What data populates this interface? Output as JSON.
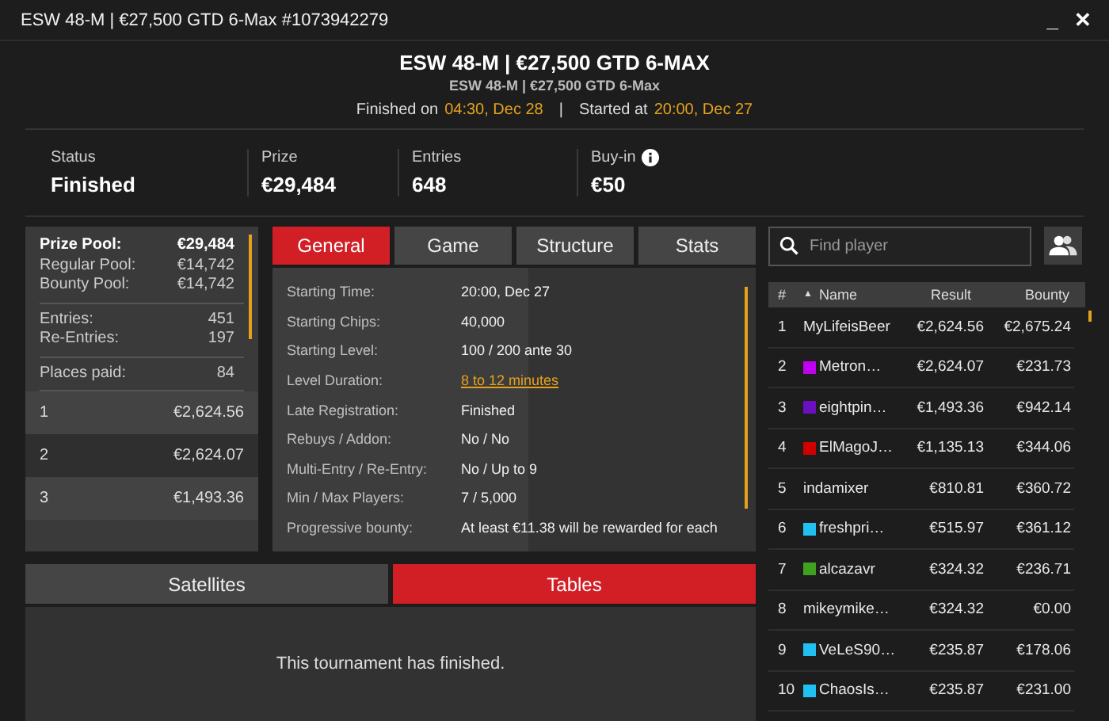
{
  "window": {
    "title": "ESW 48-M | €27,500 GTD 6-Max #1073942279",
    "controls": [
      "_",
      "✕"
    ]
  },
  "header": {
    "title": "ESW 48-M | €27,500 GTD 6-MAX",
    "subtitle": "ESW 48-M | €27,500 GTD 6-Max",
    "finished_label": "Finished on",
    "finished_time": "04:30, Dec 28",
    "separator": "|",
    "started_label": "Started at",
    "started_time": "20:00, Dec 27"
  },
  "stats": [
    {
      "label": "Status",
      "value": "Finished",
      "info": false
    },
    {
      "label": "Prize",
      "value": "€29,484",
      "info": false
    },
    {
      "label": "Entries",
      "value": "648",
      "info": false
    },
    {
      "label": "Buy-in",
      "value": "€50",
      "info": true
    }
  ],
  "prize_summary": {
    "groups": [
      [
        {
          "label": "Prize Pool:",
          "value": "€29,484",
          "bold": true
        },
        {
          "label": "Regular Pool:",
          "value": "€14,742",
          "bold": false
        },
        {
          "label": "Bounty Pool:",
          "value": "€14,742",
          "bold": false
        }
      ],
      [
        {
          "label": "Entries:",
          "value": "451",
          "bold": false
        },
        {
          "label": "Re-Entries:",
          "value": "197",
          "bold": false
        }
      ],
      [
        {
          "label": "Places paid:",
          "value": "84",
          "bold": false
        }
      ]
    ],
    "places": [
      {
        "place": "1",
        "prize": "€2,624.56"
      },
      {
        "place": "2",
        "prize": "€2,624.07"
      },
      {
        "place": "3",
        "prize": "€1,493.36"
      }
    ]
  },
  "tabs": [
    {
      "label": "General",
      "selected": true
    },
    {
      "label": "Game",
      "selected": false
    },
    {
      "label": "Structure",
      "selected": false
    },
    {
      "label": "Stats",
      "selected": false
    }
  ],
  "details": [
    {
      "label": "Starting Time:",
      "value": "20:00, Dec 27",
      "kind": "text"
    },
    {
      "label": "Starting Chips:",
      "value": "40,000",
      "kind": "text"
    },
    {
      "label": "Starting Level:",
      "value": "100 / 200 ante 30",
      "kind": "text"
    },
    {
      "label": "Level Duration:",
      "value": "8 to 12 minutes",
      "kind": "link"
    },
    {
      "label": "Late Registration:",
      "value": "Finished",
      "kind": "text"
    },
    {
      "label": "Rebuys / Addon:",
      "value": "No / No",
      "kind": "text"
    },
    {
      "label": "Multi-Entry / Re-Entry:",
      "value": "No / Up to 9",
      "kind": "text"
    },
    {
      "label": "Min / Max Players:",
      "value": "7 / 5,000",
      "kind": "text"
    },
    {
      "label": "Progressive bounty:",
      "value": "At least €11.38 will be rewarded for each",
      "kind": "text"
    }
  ],
  "bottom_tabs": [
    {
      "label": "Satellites",
      "selected": false
    },
    {
      "label": "Tables",
      "selected": true
    }
  ],
  "bottom_message": "This tournament has finished.",
  "players": {
    "search": {
      "placeholder": "Find player"
    },
    "columns": [
      "#",
      "▲",
      "Name",
      "Result",
      "Bounty"
    ],
    "rows": [
      {
        "rank": "1",
        "name": "MyLifeisBeer",
        "result": "€2,624.56",
        "bounty": "€2,675.24"
      },
      {
        "rank": "2",
        "name": "Metron…",
        "result": "€2,624.07",
        "bounty": "€231.73",
        "color": "#c000f0"
      },
      {
        "rank": "3",
        "name": "eightpin…",
        "result": "€1,493.36",
        "bounty": "€942.14",
        "color": "#6a10c0"
      },
      {
        "rank": "4",
        "name": "ElMagoJ…",
        "result": "€1,135.13",
        "bounty": "€344.06",
        "color": "#d00000"
      },
      {
        "rank": "5",
        "name": "indamixer",
        "result": "€810.81",
        "bounty": "€360.72"
      },
      {
        "rank": "6",
        "name": "freshpri…",
        "result": "€515.97",
        "bounty": "€361.12",
        "color": "#20c0f0"
      },
      {
        "rank": "7",
        "name": "alcazavr",
        "result": "€324.32",
        "bounty": "€236.71",
        "color": "#40a020"
      },
      {
        "rank": "8",
        "name": "mikeymike…",
        "result": "€324.32",
        "bounty": "€0.00"
      },
      {
        "rank": "9",
        "name": "VeLeS90…",
        "result": "€235.87",
        "bounty": "€178.06",
        "color": "#20c0f0"
      },
      {
        "rank": "10",
        "name": "ChaosIs…",
        "result": "€235.87",
        "bounty": "€231.00",
        "color": "#20c0f0"
      }
    ]
  }
}
